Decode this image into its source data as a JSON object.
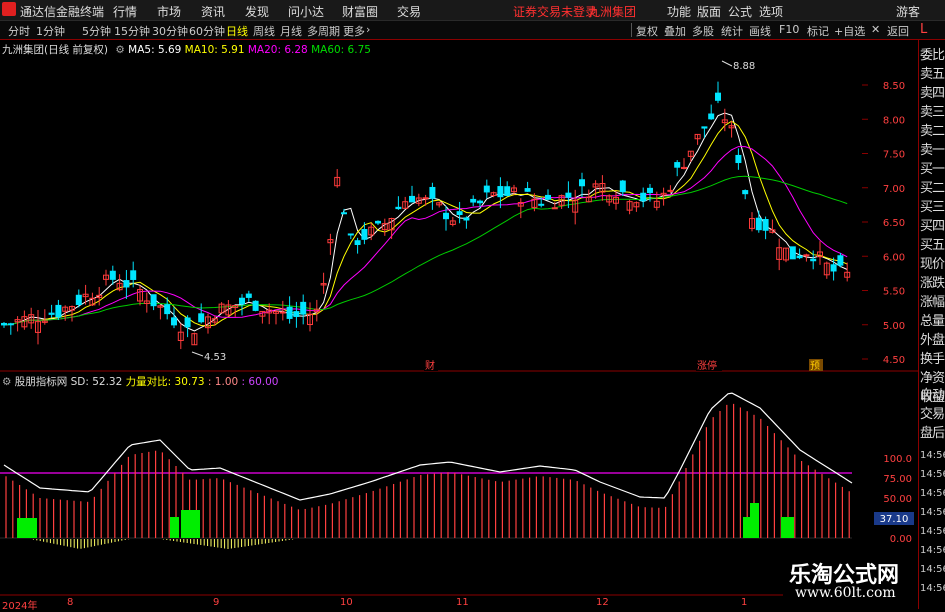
{
  "menubar": {
    "app_title": "通达信金融终端",
    "menus": [
      "行情",
      "市场",
      "资讯",
      "发现",
      "问小达",
      "财富圈",
      "交易"
    ],
    "warning": "证券交易未登录",
    "stock": "九洲集团",
    "right": [
      "功能",
      "版面",
      "公式",
      "选项"
    ],
    "guest": "游客"
  },
  "toolbar": {
    "periods": [
      "分时",
      "1分钟",
      "5分钟",
      "15分钟",
      "30分钟",
      "60分钟",
      "日线",
      "周线",
      "月线",
      "多周期",
      "更多"
    ],
    "active": "日线",
    "tools": [
      "复权",
      "叠加",
      "多股",
      "统计",
      "画线",
      "F10",
      "标记",
      "+自选",
      "返回"
    ]
  },
  "main_info": {
    "title": "九洲集团(日线 前复权)",
    "ma5": "MA5: 5.69",
    "ma10": "MA10: 5.91",
    "ma20": "MA20: 6.28",
    "ma60": "MA60: 6.75",
    "colors": {
      "ma5": "#ffffff",
      "ma10": "#ffff00",
      "ma20": "#ff00ff",
      "ma60": "#00cc00"
    }
  },
  "sub_info": {
    "title": "股朋指标网",
    "sd": "SD: 52.32",
    "ratio_label": "力量对比: 30.73",
    "v1": ": 1.00",
    "v2": ": 60.00"
  },
  "price_axis": [
    "8.50",
    "8.00",
    "7.50",
    "7.00",
    "6.50",
    "6.00",
    "5.50",
    "5.00",
    "4.50"
  ],
  "sub_axis": [
    "100.0",
    "75.00",
    "50.00",
    "25.00",
    "0.00"
  ],
  "sub_axis_highlight": "37.10",
  "annotations": {
    "high": "8.88",
    "low": "4.53",
    "marks": [
      "财",
      "涨停",
      "预"
    ]
  },
  "right_panel": {
    "labels": [
      "L",
      "委比",
      "卖五",
      "卖四",
      "卖三",
      "卖二",
      "卖一",
      "买一",
      "买二",
      "买三",
      "买四",
      "买五",
      "现价",
      "涨跌",
      "涨幅",
      "总量",
      "外盘",
      "换手",
      "净资",
      "收益"
    ],
    "labels2": [
      "自动",
      "交易",
      "盘后"
    ],
    "times": [
      "14:56",
      "14:56",
      "14:56",
      "14:56",
      "14:56",
      "14:56",
      "14:56",
      "14:56"
    ]
  },
  "x_axis": [
    "2024年",
    "8",
    "9",
    "10",
    "11",
    "12",
    "1"
  ],
  "watermark": {
    "cn": "乐淘公式网",
    "url": "www.60lt.com"
  }
}
